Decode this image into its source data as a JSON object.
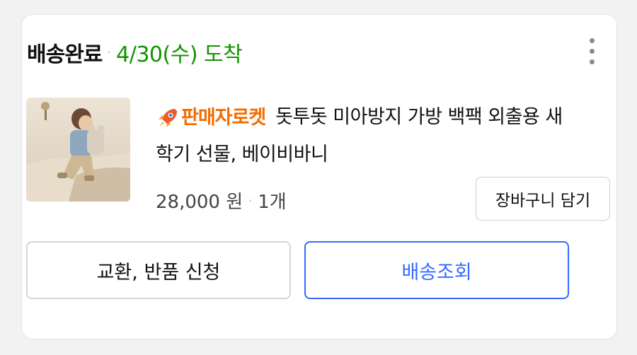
{
  "order": {
    "status_label": "배송완료",
    "separator": "·",
    "arrival_text": "4/30(수) 도착"
  },
  "menu": {
    "icon": "more-vertical-icon"
  },
  "product": {
    "image_icon": "product-photo-child-backpack",
    "badge_icon": "rocket-icon",
    "badge_label": "판매자로켓",
    "title": "돗투돗 미아방지 가방 백팩 외출용 새학기 선물, 베이비바니",
    "price": "28,000 원",
    "qty_separator": "·",
    "quantity": "1개"
  },
  "actions": {
    "add_to_cart": "장바구니 담기",
    "exchange_return": "교환, 반품 신청",
    "track_delivery": "배송조회"
  },
  "colors": {
    "arrival_green": "#129300",
    "badge_orange": "#f36d00",
    "primary_blue": "#346aff"
  }
}
